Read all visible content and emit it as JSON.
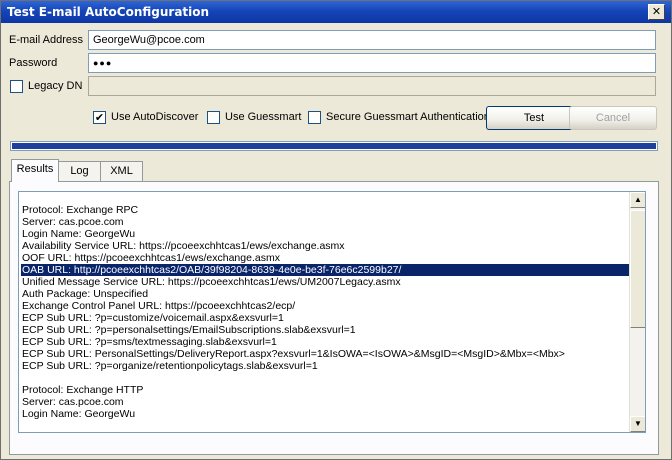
{
  "window": {
    "title": "Test E-mail AutoConfiguration",
    "close_glyph": "✕"
  },
  "form": {
    "email_label": "E-mail Address",
    "email_value": "GeorgeWu@pcoe.com",
    "password_label": "Password",
    "password_value": "●●●",
    "legacy_dn_label": "Legacy DN",
    "legacy_dn_value": "",
    "legacy_dn_checked": false
  },
  "options": {
    "use_autodiscover": {
      "label": "Use AutoDiscover",
      "checked": true
    },
    "use_guessmart": {
      "label": "Use Guessmart",
      "checked": false
    },
    "secure_guessmart": {
      "label": "Secure Guessmart Authentication",
      "checked": false
    },
    "check_glyph": "✔"
  },
  "buttons": {
    "test": "Test",
    "cancel": "Cancel"
  },
  "progress": {
    "fraction": 1.0,
    "color": "#1e3f9c"
  },
  "tabs": [
    {
      "label": "Results",
      "active": true
    },
    {
      "label": "Log",
      "active": false
    },
    {
      "label": "XML",
      "active": false
    }
  ],
  "results": {
    "selected_index": 5,
    "lines": [
      "Protocol: Exchange RPC",
      "Server: cas.pcoe.com",
      "Login Name: GeorgeWu",
      "Availability Service URL: https://pcoeexchhtcas1/ews/exchange.asmx",
      "OOF URL: https://pcoeexchhtcas1/ews/exchange.asmx",
      "OAB URL: http://pcoeexchhtcas2/OAB/39f98204-8639-4e0e-be3f-76e6c2599b27/",
      "Unified Message Service URL: https://pcoeexchhtcas1/ews/UM2007Legacy.asmx",
      "Auth Package: Unspecified",
      "Exchange Control Panel URL: https://pcoeexchhtcas2/ecp/",
      "ECP Sub URL: ?p=customize/voicemail.aspx&exsvurl=1",
      "ECP Sub URL: ?p=personalsettings/EmailSubscriptions.slab&exsvurl=1",
      "ECP Sub URL: ?p=sms/textmessaging.slab&exsvurl=1",
      "ECP Sub URL: PersonalSettings/DeliveryReport.aspx?exsvurl=1&IsOWA=<IsOWA>&MsgID=<MsgID>&Mbx=<Mbx>",
      "ECP Sub URL: ?p=organize/retentionpolicytags.slab&exsvurl=1",
      "",
      "Protocol: Exchange HTTP",
      "Server: cas.pcoe.com",
      "Login Name: GeorgeWu"
    ]
  },
  "scrollbar": {
    "up_glyph": "▲",
    "down_glyph": "▼"
  }
}
